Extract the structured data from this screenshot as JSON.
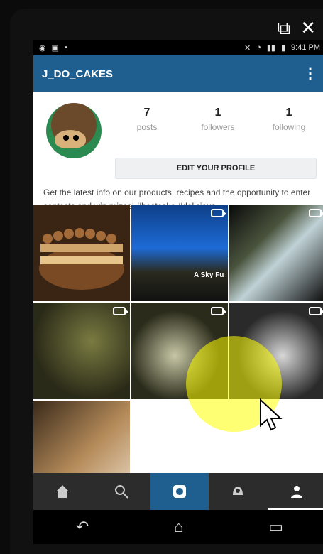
{
  "overlay": {
    "open_external_icon": "open-external-icon",
    "close_icon": "close-icon"
  },
  "statusbar": {
    "time": "9:41 PM"
  },
  "topbar": {
    "username": "J_DO_CAKES"
  },
  "profile": {
    "stats": [
      {
        "value": "7",
        "label": "posts"
      },
      {
        "value": "1",
        "label": "followers"
      },
      {
        "value": "1",
        "label": "following"
      }
    ],
    "edit_label": "EDIT YOUR PROFILE",
    "bio": "Get the latest info on our products, recipes and the opportunity to enter contests and win prizes! #bestcake #delicious"
  },
  "tabs": [
    {
      "name": "grid-view",
      "icon": "grid-icon"
    },
    {
      "name": "list-view",
      "icon": "list-icon"
    },
    {
      "name": "places",
      "icon": "location-pin-icon"
    },
    {
      "name": "tagged",
      "icon": "tagged-photo-icon"
    }
  ],
  "grid": {
    "tiles": [
      {
        "kind": "photo"
      },
      {
        "kind": "video",
        "caption": "A Sky Fu"
      },
      {
        "kind": "video"
      },
      {
        "kind": "video"
      },
      {
        "kind": "video"
      },
      {
        "kind": "video"
      },
      {
        "kind": "photo"
      }
    ]
  },
  "bottomnav": [
    {
      "name": "home",
      "icon": "home-icon"
    },
    {
      "name": "search",
      "icon": "search-icon"
    },
    {
      "name": "camera",
      "icon": "camera-icon"
    },
    {
      "name": "activity",
      "icon": "activity-icon"
    },
    {
      "name": "profile",
      "icon": "profile-icon"
    }
  ],
  "androidbar": [
    {
      "name": "back",
      "icon": "back-icon"
    },
    {
      "name": "home",
      "icon": "android-home-icon"
    },
    {
      "name": "recent-apps",
      "icon": "recent-apps-icon"
    }
  ]
}
